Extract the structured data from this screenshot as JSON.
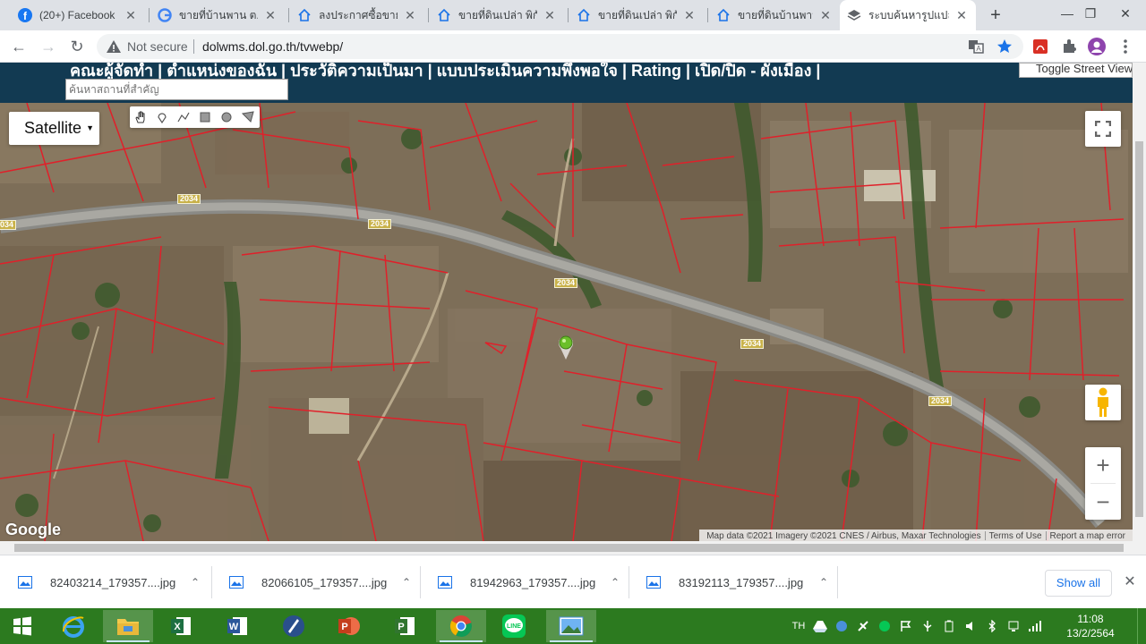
{
  "browser": {
    "tabs": [
      {
        "title": "(20+) Facebook",
        "icon": "facebook-icon",
        "active": false
      },
      {
        "title": "ขายที่บ้านพาน ต.อ่",
        "icon": "google-icon",
        "active": false
      },
      {
        "title": "ลงประกาศซื้อขายบ้",
        "icon": "house-icon",
        "active": false
      },
      {
        "title": "ขายที่ดินเปล่า พิกัด",
        "icon": "house-icon",
        "active": false
      },
      {
        "title": "ขายที่ดินเปล่า พิกัด",
        "icon": "house-icon",
        "active": false
      },
      {
        "title": "ขายที่ดินบ้านพาน ใ",
        "icon": "house-icon",
        "active": false
      },
      {
        "title": "ระบบค้นหารูปแปลงที่",
        "icon": "layers-icon",
        "active": true
      }
    ],
    "address": {
      "security_label": "Not secure",
      "url": "dolwms.dol.go.th/tvwebp/"
    }
  },
  "site": {
    "nav_text": "คณะผู้จัดทำ | ตำแหน่งของฉัน | ประวัติความเป็นมา | แบบประเมินความพึงพอใจ | Rating | เปิด/ปิด - ผังเมือง |",
    "search_placeholder": "ค้นหาสถานที่สำคัญ",
    "streetview_toggle": "Toggle Street View"
  },
  "map": {
    "map_type": "Satellite",
    "road_number": "2034",
    "attribution": {
      "data": "Map data ©2021 Imagery ©2021 CNES / Airbus, Maxar Technologies",
      "terms": "Terms of Use",
      "report": "Report a map error"
    },
    "logo": "Google",
    "zoom_in": "+",
    "zoom_out": "−"
  },
  "downloads": {
    "items": [
      {
        "name": "82403214_179357....jpg"
      },
      {
        "name": "82066105_179357....jpg"
      },
      {
        "name": "81942963_179357....jpg"
      },
      {
        "name": "83192113_179357....jpg"
      }
    ],
    "show_all": "Show all"
  },
  "taskbar": {
    "lang": "TH",
    "time": "11:08",
    "date": "13/2/2564",
    "apps": [
      "windows-start-icon",
      "internet-explorer-icon",
      "file-explorer-icon",
      "excel-icon",
      "word-icon",
      "app-icon",
      "powerpoint-icon",
      "project-icon",
      "chrome-icon",
      "line-icon",
      "photos-icon"
    ]
  },
  "colors": {
    "parcel_lines": "#e0202a",
    "site_header": "#123a52",
    "taskbar": "#2c7a1f"
  }
}
